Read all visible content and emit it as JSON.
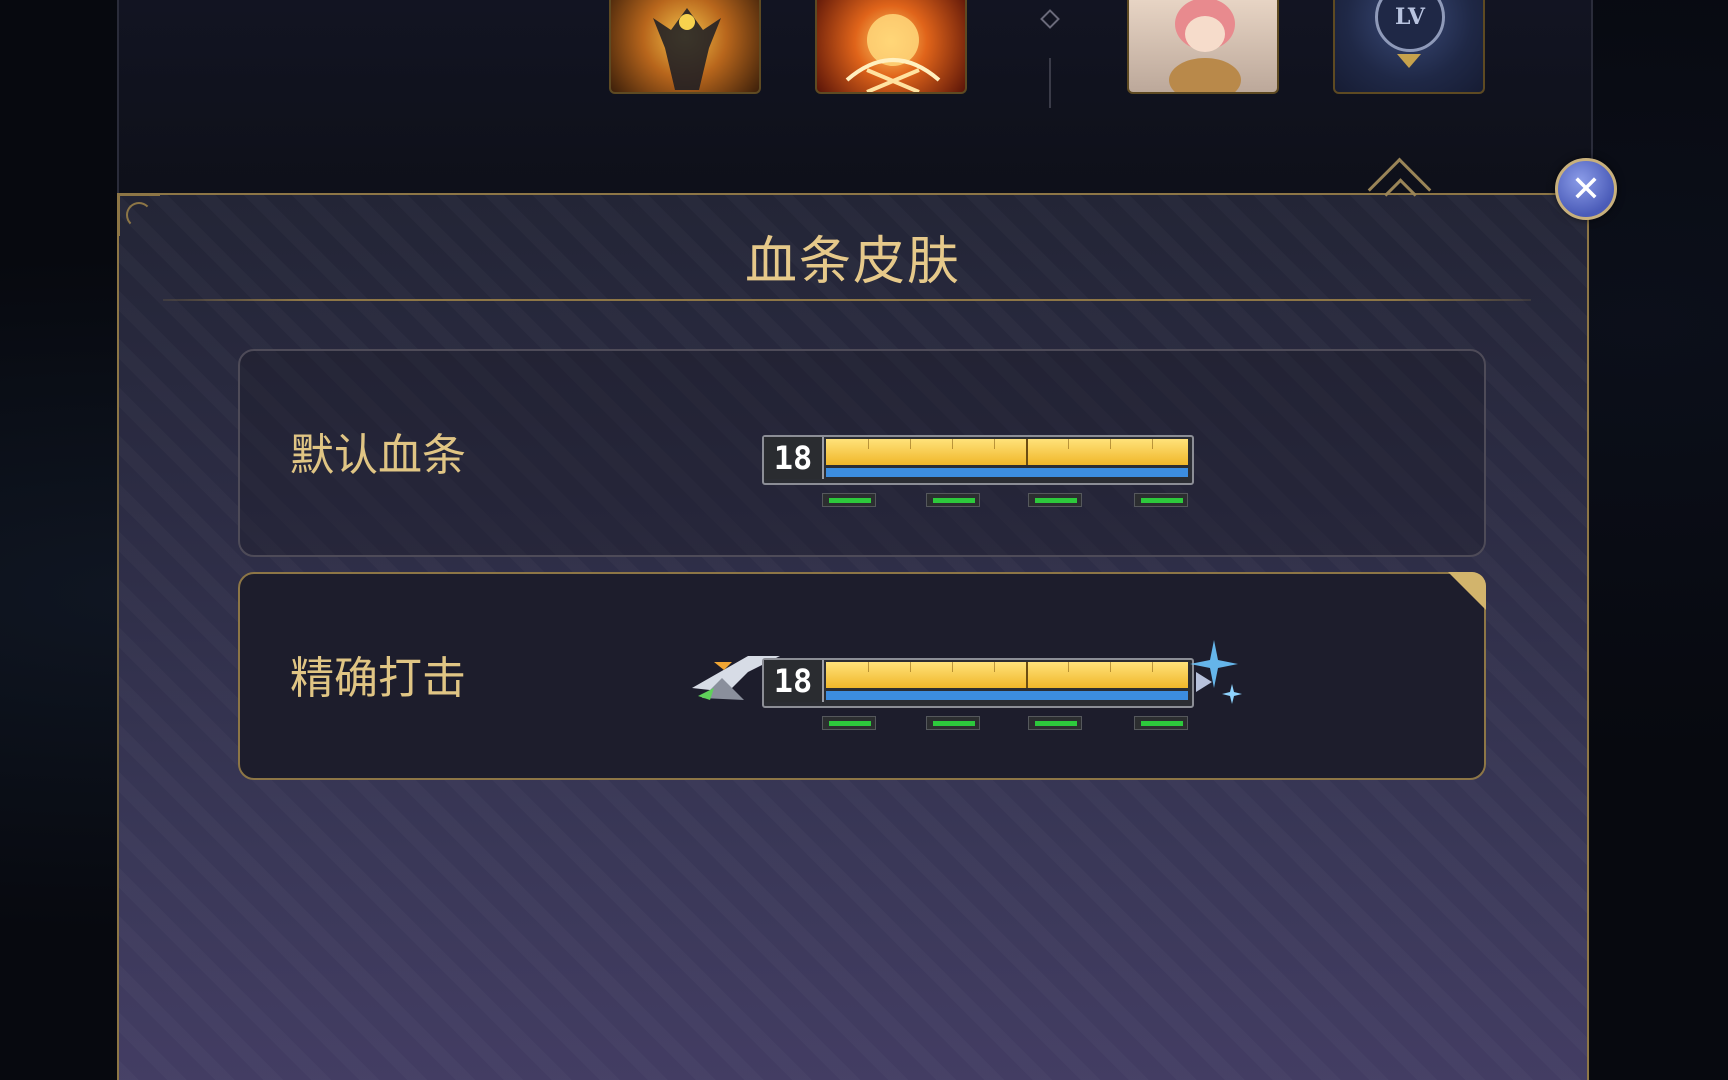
{
  "top_bar": {
    "icons": [
      {
        "name": "armored-hero-avatar",
        "accent": "#f3c14a"
      },
      {
        "name": "fire-emblem-avatar",
        "accent": "#e0641a"
      },
      {
        "name": "anime-girl-avatar",
        "accent": "#e7d4c4"
      },
      {
        "name": "level-frame-avatar",
        "accent": "#3a4a78"
      }
    ],
    "level_badge_text": "LV"
  },
  "panel": {
    "title": "血条皮肤",
    "options": [
      {
        "label": "默认血条",
        "level": "18",
        "hp_fraction": 1.0,
        "mana_fraction": 1.0,
        "selected": false
      },
      {
        "label": "精确打击",
        "level": "18",
        "hp_fraction": 1.0,
        "mana_fraction": 1.0,
        "selected": true
      }
    ]
  },
  "colors": {
    "gold_text": "#e6c98a",
    "border_gold": "#8d7646",
    "hp_yellow": "#f0b72a",
    "mana_blue": "#3c8de0",
    "pip_green": "#2dc93c",
    "close_button": "#4a5bb8"
  }
}
